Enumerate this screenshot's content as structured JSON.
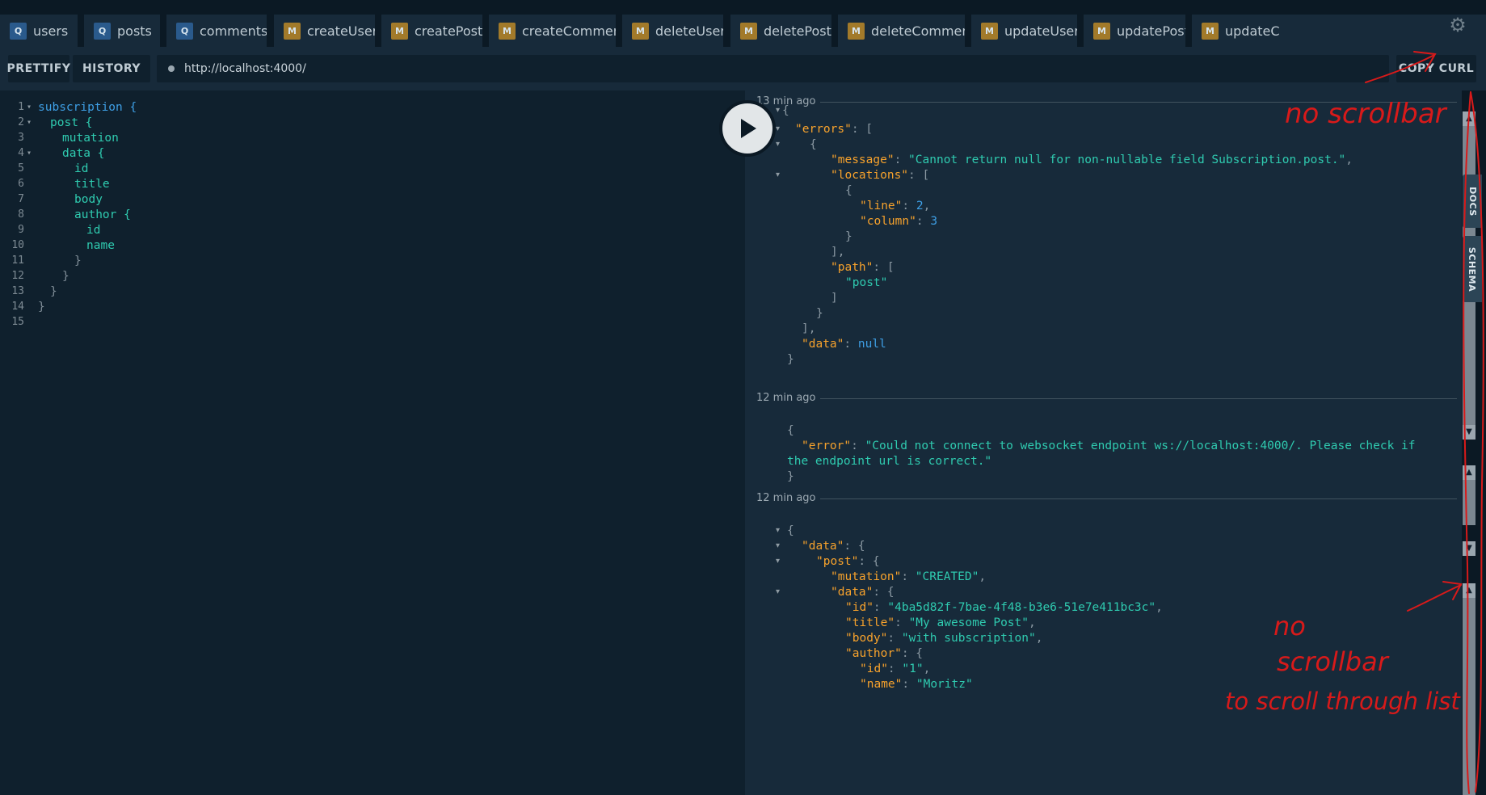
{
  "tabs": [
    {
      "badge": "Q",
      "kind": "query",
      "label": "users"
    },
    {
      "badge": "Q",
      "kind": "query",
      "label": "posts"
    },
    {
      "badge": "Q",
      "kind": "query",
      "label": "comments"
    },
    {
      "badge": "M",
      "kind": "mutation",
      "label": "createUser"
    },
    {
      "badge": "M",
      "kind": "mutation",
      "label": "createPost"
    },
    {
      "badge": "M",
      "kind": "mutation",
      "label": "createComment"
    },
    {
      "badge": "M",
      "kind": "mutation",
      "label": "deleteUser"
    },
    {
      "badge": "M",
      "kind": "mutation",
      "label": "deletePost"
    },
    {
      "badge": "M",
      "kind": "mutation",
      "label": "deleteComment"
    },
    {
      "badge": "M",
      "kind": "mutation",
      "label": "updateUser"
    },
    {
      "badge": "M",
      "kind": "mutation",
      "label": "updatePost"
    },
    {
      "badge": "M",
      "kind": "mutation",
      "label": "updateC"
    }
  ],
  "toolbar": {
    "prettify": "PRETTIFY",
    "history": "HISTORY",
    "url": "http://localhost:4000/",
    "copy_curl": "COPY CURL"
  },
  "editor": {
    "lines": [
      {
        "n": "1",
        "fold": true,
        "indent": 0,
        "text": "subscription {"
      },
      {
        "n": "2",
        "fold": true,
        "indent": 1,
        "text": "post {"
      },
      {
        "n": "3",
        "fold": false,
        "indent": 2,
        "text": "mutation"
      },
      {
        "n": "4",
        "fold": true,
        "indent": 2,
        "text": "data {"
      },
      {
        "n": "5",
        "fold": false,
        "indent": 3,
        "text": "id"
      },
      {
        "n": "6",
        "fold": false,
        "indent": 3,
        "text": "title"
      },
      {
        "n": "7",
        "fold": false,
        "indent": 3,
        "text": "body"
      },
      {
        "n": "8",
        "fold": false,
        "indent": 3,
        "text": "author {"
      },
      {
        "n": "9",
        "fold": false,
        "indent": 4,
        "text": "id"
      },
      {
        "n": "10",
        "fold": false,
        "indent": 4,
        "text": "name"
      },
      {
        "n": "11",
        "fold": false,
        "indent": 3,
        "text": "}"
      },
      {
        "n": "12",
        "fold": false,
        "indent": 2,
        "text": "}"
      },
      {
        "n": "13",
        "fold": false,
        "indent": 1,
        "text": "}"
      },
      {
        "n": "14",
        "fold": false,
        "indent": 0,
        "text": "}"
      },
      {
        "n": "15",
        "fold": false,
        "indent": 0,
        "text": ""
      }
    ]
  },
  "results": {
    "ts1": "13 min ago",
    "ts2": "12 min ago",
    "ts3": "12 min ago",
    "block1": {
      "errors_key": "\"errors\"",
      "message_key": "\"message\"",
      "message_val": "\"Cannot return null for non-nullable field Subscription.post.\"",
      "locations_key": "\"locations\"",
      "line_key": "\"line\"",
      "line_val": "2",
      "column_key": "\"column\"",
      "column_val": "3",
      "path_key": "\"path\"",
      "path_val": "\"post\"",
      "data_key": "\"data\"",
      "data_val": "null"
    },
    "block2": {
      "error_key": "\"error\"",
      "error_val_1": "\"Could not connect to websocket endpoint ws://localhost:4000/. Please check if",
      "error_val_2": "the endpoint url is correct.\""
    },
    "block3": {
      "data_key": "\"data\"",
      "post_key": "\"post\"",
      "mutation_key": "\"mutation\"",
      "mutation_val": "\"CREATED\"",
      "inner_data_key": "\"data\"",
      "id_key": "\"id\"",
      "id_val": "\"4ba5d82f-7bae-4f48-b3e6-51e7e411bc3c\"",
      "title_key": "\"title\"",
      "title_val": "\"My awesome Post\"",
      "body_key": "\"body\"",
      "body_val": "\"with subscription\"",
      "author_key": "\"author\"",
      "author_id_key": "\"id\"",
      "author_id_val": "\"1\"",
      "name_key": "\"name\"",
      "name_val": "\"Moritz\""
    }
  },
  "side_tabs": {
    "docs": "DOCS",
    "schema": "SCHEMA"
  },
  "annotations": {
    "top_note": "no scrollbar",
    "bottom_note_1": "no",
    "bottom_note_2": "scrollbar",
    "bottom_note_3": "to scroll through list",
    "ink_color": "#d81a1a"
  },
  "colors": {
    "background": "#0f202d",
    "panel": "#172a3a",
    "query_badge": "#2a5a8c",
    "mutation_badge": "#a27a2a",
    "json_key": "#f7a22c",
    "json_string": "#2fcbb0",
    "json_number": "#3e9fe5"
  }
}
